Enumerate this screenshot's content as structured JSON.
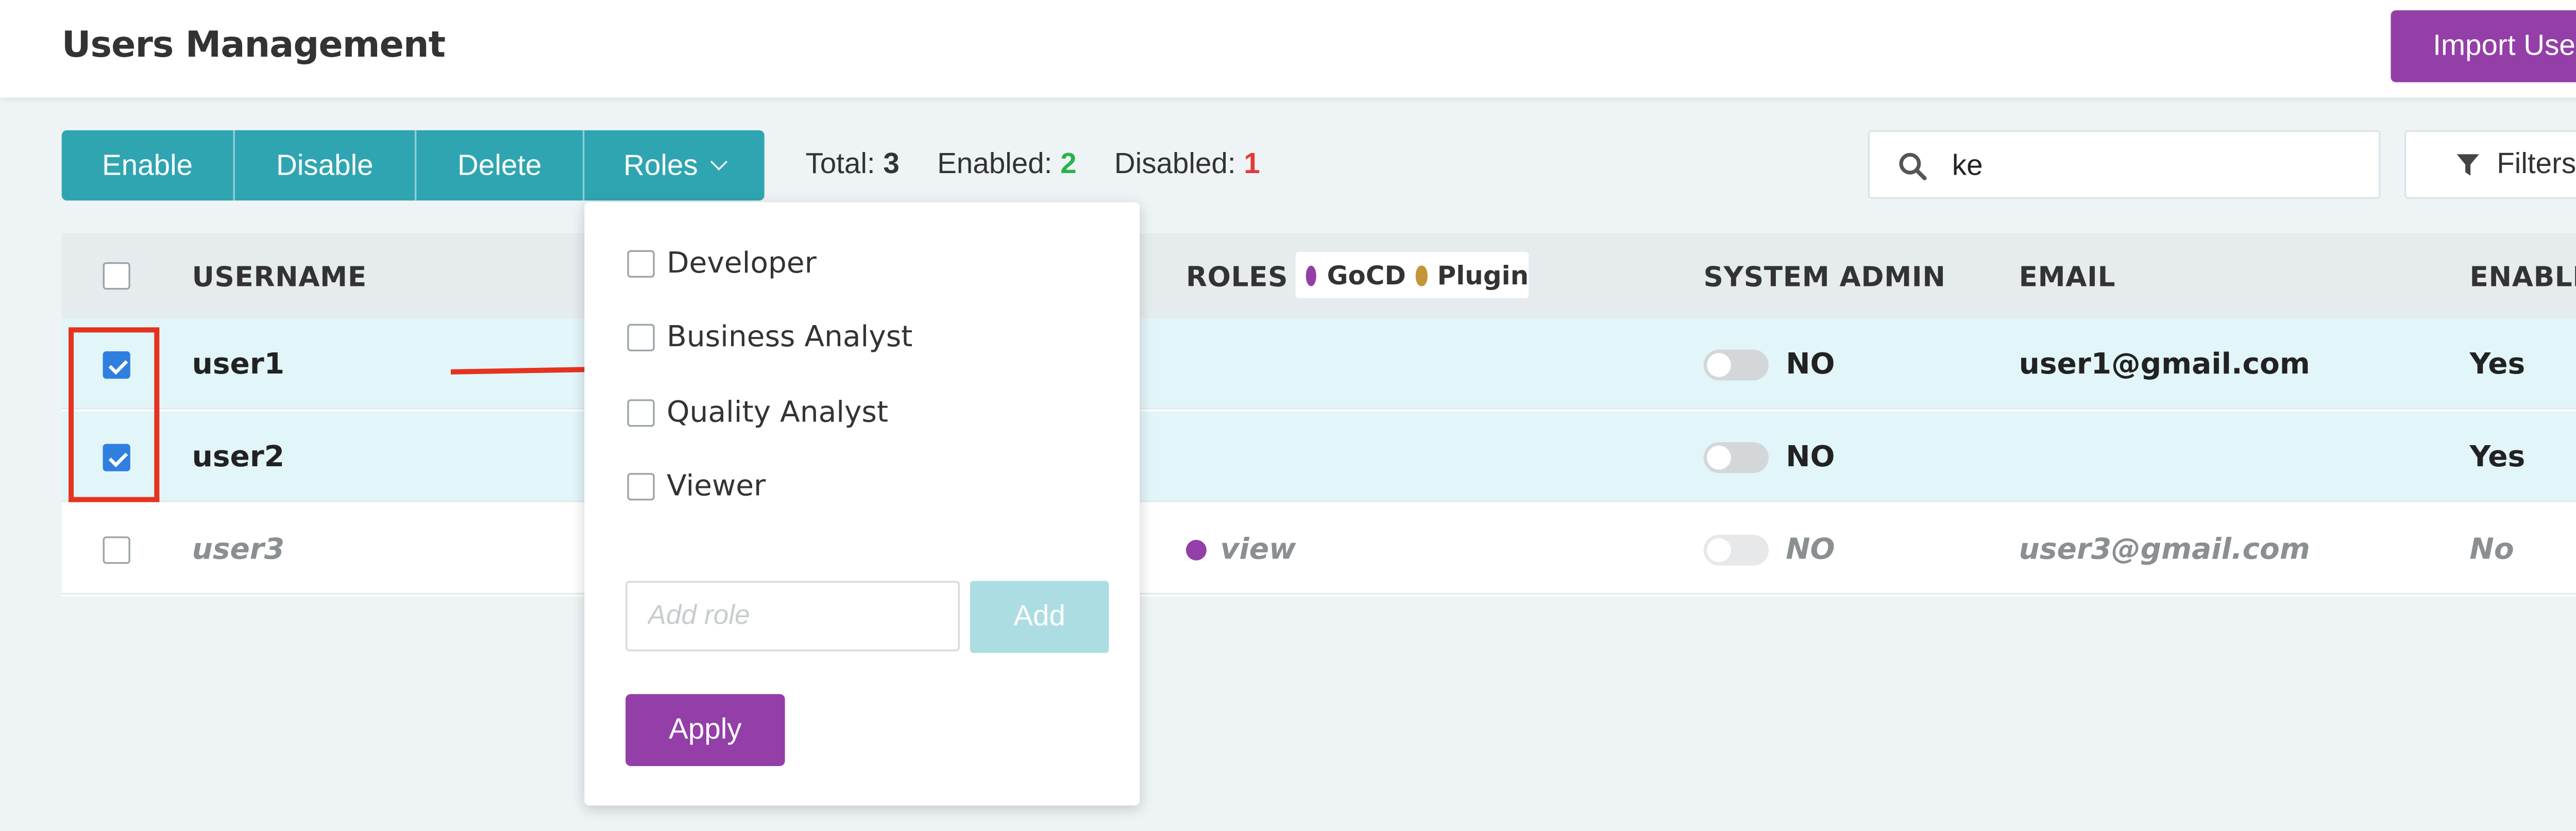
{
  "header": {
    "title": "Users Management",
    "import_label": "Import User"
  },
  "toolbar": {
    "enable_label": "Enable",
    "disable_label": "Disable",
    "delete_label": "Delete",
    "roles_label": "Roles",
    "total_label": "Total:",
    "total_value": "3",
    "enabled_label": "Enabled:",
    "enabled_value": "2",
    "disabled_label": "Disabled:",
    "disabled_value": "1"
  },
  "search": {
    "value": "ke"
  },
  "filters": {
    "label": "Filters"
  },
  "table": {
    "columns": {
      "username": "USERNAME",
      "roles": "ROLES",
      "system_admin": "SYSTEM ADMIN",
      "email": "EMAIL",
      "enabled": "ENABLED"
    },
    "legend": [
      {
        "name": "GoCD",
        "color": "#943ea8"
      },
      {
        "name": "Plugin",
        "color": "#c4963a"
      }
    ],
    "rows": [
      {
        "username": "user1",
        "roles": "",
        "admin": "NO",
        "email": "user1@gmail.com",
        "enabled": "Yes",
        "selected": true
      },
      {
        "username": "user2",
        "roles": "",
        "admin": "NO",
        "email": "",
        "enabled": "Yes",
        "selected": true
      },
      {
        "username": "user3",
        "roles": "view",
        "admin": "NO",
        "email": "user3@gmail.com",
        "enabled": "No",
        "selected": false
      }
    ]
  },
  "roles_dropdown": {
    "options": [
      "Developer",
      "Business Analyst",
      "Quality Analyst",
      "Viewer"
    ],
    "add_role_placeholder": "Add role",
    "add_label": "Add",
    "apply_label": "Apply"
  },
  "colors": {
    "accent_teal": "#2fa5b1",
    "accent_purple": "#943ea8",
    "highlight_red": "#e5331f"
  }
}
